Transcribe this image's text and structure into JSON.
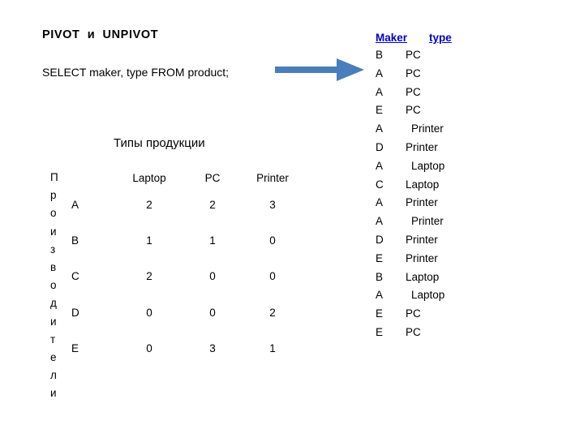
{
  "slide": {
    "heading": "PIVOT  и  UNPIVOT",
    "query": "SELECT maker, type FROM product;",
    "arrow_icon": "right-arrow-icon",
    "arrow_color": "#4A7EBB",
    "header_color": "#0000CC",
    "text_color": "#000000",
    "background_color": "#FFFFFF"
  },
  "pivot": {
    "title": "Типы продукции",
    "row_axis_label": "Производители",
    "row_axis_letters": [
      "П",
      "р",
      "о",
      "и",
      "з",
      "в",
      "о",
      "д",
      "и",
      "т",
      "е",
      "л",
      "и"
    ],
    "columns": [
      "",
      "Laptop",
      "PC",
      "Printer"
    ],
    "rows": [
      {
        "maker": "A",
        "laptop": "2",
        "pc": "2",
        "printer": "3"
      },
      {
        "maker": "B",
        "laptop": "1",
        "pc": "1",
        "printer": "0"
      },
      {
        "maker": "C",
        "laptop": "2",
        "pc": "0",
        "printer": "0"
      },
      {
        "maker": "D",
        "laptop": "0",
        "pc": "0",
        "printer": "2"
      },
      {
        "maker": "E",
        "laptop": "0",
        "pc": "3",
        "printer": "1"
      }
    ]
  },
  "result": {
    "columns": {
      "maker": "Maker",
      "type": "type"
    },
    "rows": [
      {
        "maker": "B",
        "type": "PC",
        "indent": false
      },
      {
        "maker": "A",
        "type": "PC",
        "indent": false
      },
      {
        "maker": "A",
        "type": "PC",
        "indent": false
      },
      {
        "maker": "E",
        "type": "PC",
        "indent": false
      },
      {
        "maker": "A",
        "type": "Printer",
        "indent": true
      },
      {
        "maker": "D",
        "type": "Printer",
        "indent": false
      },
      {
        "maker": "A",
        "type": "Laptop",
        "indent": true
      },
      {
        "maker": "C",
        "type": "Laptop",
        "indent": false
      },
      {
        "maker": "A",
        "type": "Printer",
        "indent": false
      },
      {
        "maker": "A",
        "type": "Printer",
        "indent": true
      },
      {
        "maker": "D",
        "type": "Printer",
        "indent": false
      },
      {
        "maker": "E",
        "type": "Printer",
        "indent": false
      },
      {
        "maker": "B",
        "type": "Laptop",
        "indent": false
      },
      {
        "maker": "A",
        "type": "Laptop",
        "indent": true
      },
      {
        "maker": "E",
        "type": "PC",
        "indent": false
      },
      {
        "maker": "E",
        "type": "PC",
        "indent": false
      }
    ]
  }
}
